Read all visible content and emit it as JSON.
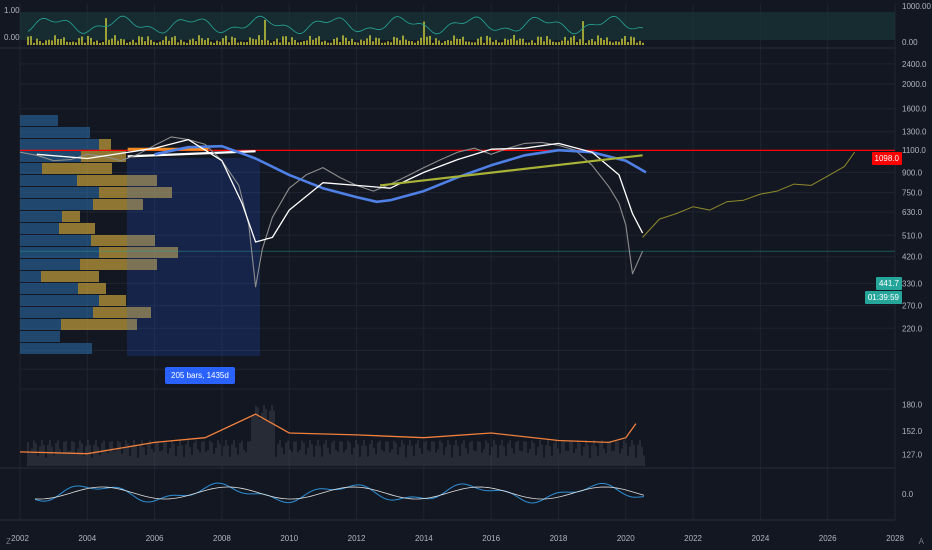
{
  "colors": {
    "background": "#131722",
    "grid": "#1f2430",
    "resistance": "#ff0000",
    "current_price": "#26a69a",
    "sma_long": "#4f80e6",
    "sma_short": "#ffffff",
    "bollinger": "#26a69a",
    "volume_profile_up": "#2c6fad",
    "volume_profile_down": "#c4a13a",
    "trendline": "#a8b236",
    "projection": "#8f8a2a",
    "histvol": "#f0803c",
    "measure_badge": "#2962ff"
  },
  "price_tags": {
    "resistance": "1098.0",
    "current": "441.7",
    "countdown": "01:39:59"
  },
  "measure": {
    "label": "205 bars, 1435d"
  },
  "bottom_bar": {
    "timezone_btn": "Z",
    "auto_btn": "A"
  },
  "chart_data": [
    {
      "type": "line",
      "panel": "top-oscillator",
      "y_ticks_left": [
        "1.00",
        "0.00"
      ],
      "y_ticks_right": [
        "1000.00",
        "0.00"
      ]
    },
    {
      "type": "line",
      "panel": "main-price",
      "scale": "log",
      "x_ticks": [
        "2002",
        "2004",
        "2006",
        "2008",
        "2010",
        "2012",
        "2014",
        "2016",
        "2018",
        "2020",
        "2022",
        "2024",
        "2026",
        "2028"
      ],
      "x_range": [
        2002,
        2028
      ],
      "y_ticks": [
        2400,
        2000,
        1600,
        1300,
        1100,
        900,
        750,
        630,
        510,
        420,
        330,
        270,
        220,
        180,
        152,
        127
      ],
      "y_range": [
        110,
        2600
      ],
      "resistance_level": 1098,
      "current_price": 441.7,
      "series": [
        {
          "role": "price",
          "x": [
            2002.0,
            2002.5,
            2003.0,
            2003.5,
            2004.0,
            2004.5,
            2005.0,
            2005.5,
            2006.0,
            2006.5,
            2007.0,
            2007.5,
            2008.0,
            2008.5,
            2008.8,
            2009.0,
            2009.2,
            2009.5,
            2010.0,
            2010.5,
            2011.0,
            2011.5,
            2012.0,
            2012.5,
            2013.0,
            2013.5,
            2014.0,
            2014.5,
            2015.0,
            2015.5,
            2016.0,
            2016.5,
            2017.0,
            2017.5,
            2018.0,
            2018.5,
            2019.0,
            2019.5,
            2019.8,
            2020.0,
            2020.2,
            2020.5
          ],
          "y": [
            1080,
            1050,
            1000,
            1010,
            1060,
            1040,
            1000,
            1060,
            1150,
            1240,
            1210,
            1160,
            1000,
            800,
            560,
            320,
            450,
            600,
            780,
            880,
            940,
            860,
            800,
            760,
            810,
            870,
            940,
            1010,
            1080,
            1120,
            1060,
            1120,
            1170,
            1180,
            1150,
            1100,
            960,
            790,
            680,
            560,
            360,
            441.7
          ]
        },
        {
          "role": "sma_long",
          "x": [
            2006.0,
            2007.0,
            2008.0,
            2009.0,
            2010.0,
            2011.0,
            2012.0,
            2012.6,
            2013.0,
            2014.0,
            2015.0,
            2016.0,
            2017.0,
            2018.0,
            2019.0,
            2020.0,
            2020.6
          ],
          "y": [
            1060,
            1130,
            1140,
            1020,
            880,
            780,
            720,
            690,
            700,
            760,
            860,
            960,
            1050,
            1100,
            1080,
            1000,
            900
          ]
        },
        {
          "role": "sma_short",
          "x": [
            2002.5,
            2004.0,
            2006.0,
            2007.0,
            2008.0,
            2008.6,
            2009.0,
            2009.5,
            2010.0,
            2011.0,
            2012.0,
            2013.0,
            2014.0,
            2015.0,
            2016.0,
            2017.0,
            2018.0,
            2019.0,
            2019.8,
            2020.2,
            2020.5
          ],
          "y": [
            1060,
            1020,
            1120,
            1210,
            1000,
            680,
            480,
            500,
            640,
            820,
            800,
            780,
            900,
            1010,
            1110,
            1120,
            1170,
            1080,
            880,
            620,
            520
          ]
        },
        {
          "role": "trendline",
          "x": [
            2012.7,
            2020.5
          ],
          "y": [
            800,
            1050
          ]
        },
        {
          "role": "projection",
          "x": [
            2020.5,
            2021.0,
            2021.5,
            2022.0,
            2022.5,
            2023.0,
            2023.5,
            2024.0,
            2024.5,
            2025.0,
            2025.5,
            2026.0,
            2026.5,
            2026.8
          ],
          "y": [
            500,
            590,
            620,
            660,
            640,
            690,
            700,
            740,
            760,
            810,
            800,
            870,
            950,
            1080
          ]
        }
      ]
    },
    {
      "type": "line",
      "panel": "historical-volatility",
      "x": [
        2002.0,
        2004.0,
        2006.0,
        2007.5,
        2009.0,
        2010.0,
        2012.0,
        2014.0,
        2016.0,
        2018.0,
        2019.5,
        2020.0,
        2020.3
      ],
      "y": [
        130,
        128,
        140,
        145,
        170,
        150,
        148,
        145,
        150,
        142,
        140,
        145,
        160
      ],
      "y_ticks": [
        180,
        152,
        127
      ]
    },
    {
      "type": "line",
      "panel": "macd",
      "y_ticks": [
        "0.0"
      ]
    }
  ]
}
